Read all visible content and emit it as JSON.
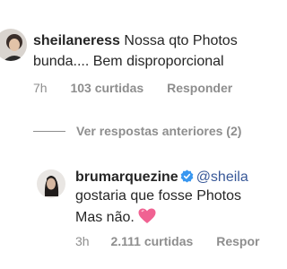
{
  "comment1": {
    "username": "sheilaneress",
    "text_line1": "Nossa qto Photos",
    "text_line2": "bunda.... Bem disproporcional",
    "time": "7h",
    "likes": "103 curtidas",
    "reply": "Responder"
  },
  "view_replies": "Ver respostas anteriores (2)",
  "comment2": {
    "username": "brumarquezine",
    "mention": "@sheila",
    "text_line2": "gostaria que fosse Photos",
    "text_line3": "Mas não.",
    "emoji": "pink-heart-emoji",
    "time": "3h",
    "likes": "2.111 curtidas",
    "reply": "Respor"
  },
  "colors": {
    "text": "#262626",
    "secondary": "#8e8e8e",
    "mention": "#385898",
    "verified": "#3897f0",
    "heart": "#f06292"
  }
}
